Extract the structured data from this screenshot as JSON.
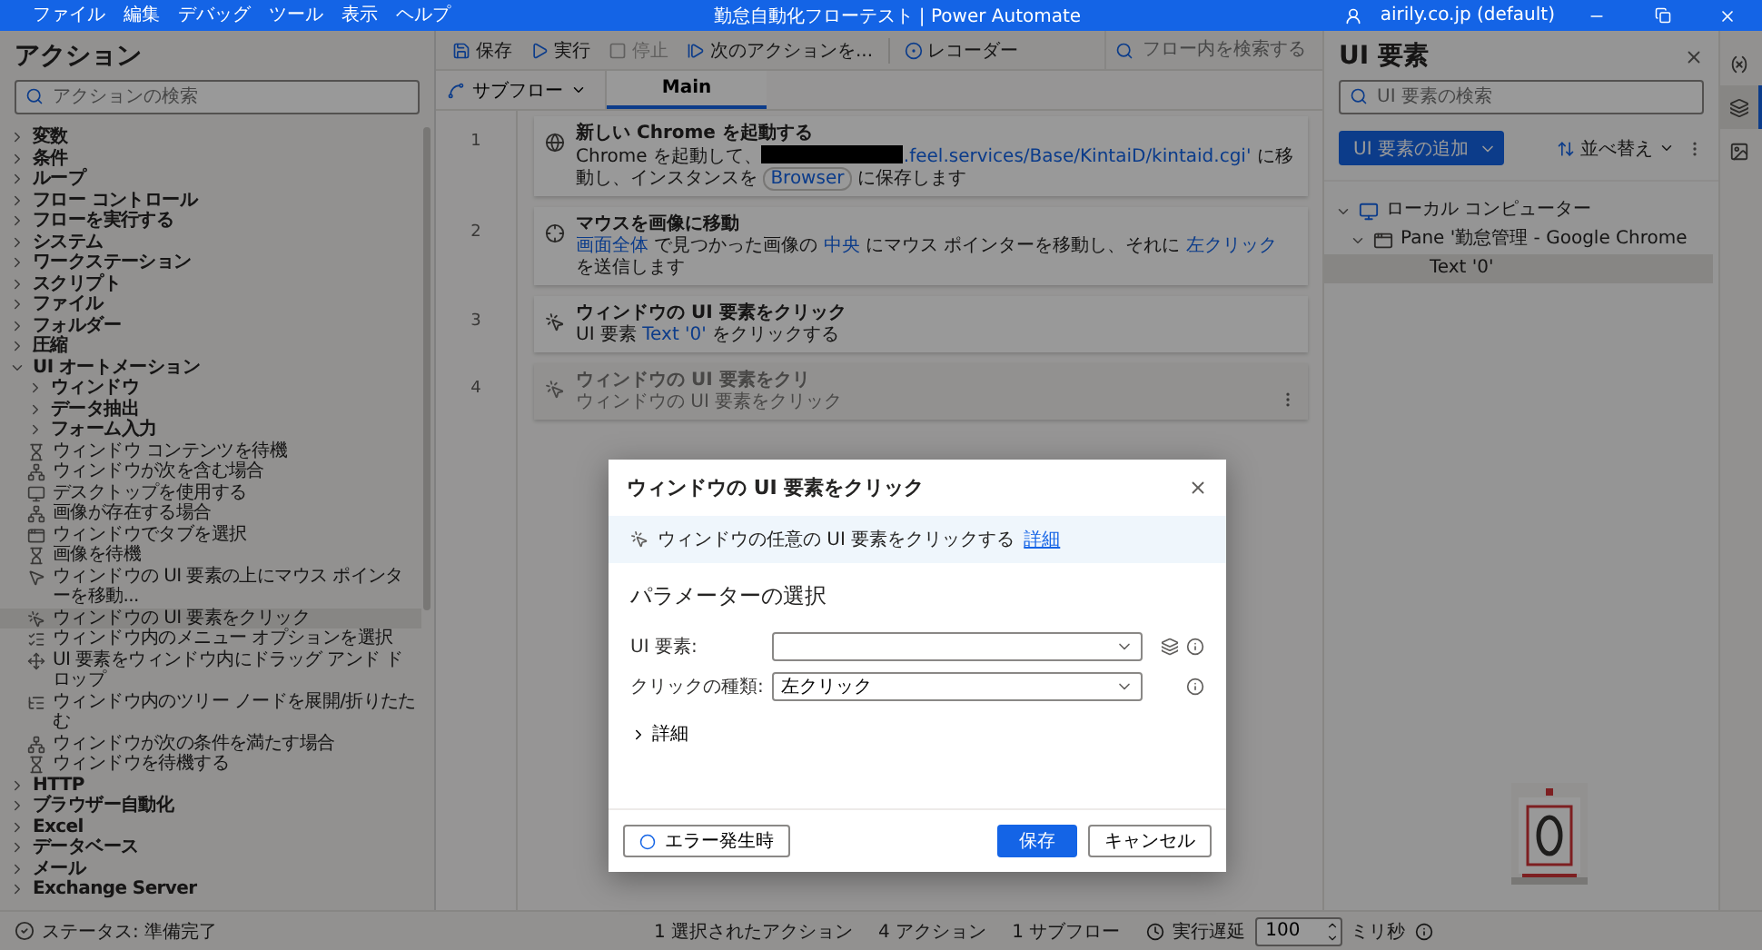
{
  "window": {
    "menu": [
      "ファイル",
      "編集",
      "デバッグ",
      "ツール",
      "表示",
      "ヘルプ"
    ],
    "title": "勤怠自動化フローテスト | Power Automate",
    "account": "airily.co.jp (default)"
  },
  "actions_panel": {
    "title": "アクション",
    "search": {
      "placeholder": "アクションの検索"
    },
    "tree": [
      {
        "label": "変数",
        "expanded": false,
        "selected": false
      },
      {
        "label": "条件",
        "expanded": false,
        "selected": false
      },
      {
        "label": "ループ",
        "expanded": false,
        "selected": false
      },
      {
        "label": "フロー コントロール",
        "expanded": false,
        "selected": false
      },
      {
        "label": "フローを実行する",
        "expanded": false,
        "selected": false
      },
      {
        "label": "システム",
        "expanded": false,
        "selected": false
      },
      {
        "label": "ワークステーション",
        "expanded": false,
        "selected": false
      },
      {
        "label": "スクリプト",
        "expanded": false,
        "selected": false
      },
      {
        "label": "ファイル",
        "expanded": false,
        "selected": false
      },
      {
        "label": "フォルダー",
        "expanded": false,
        "selected": false
      },
      {
        "label": "圧縮",
        "expanded": false,
        "selected": false
      },
      {
        "label": "UI オートメーション",
        "expanded": true,
        "selected": false,
        "children": [
          {
            "label": "ウィンドウ",
            "expanded": false,
            "selected": false
          },
          {
            "label": "データ抽出",
            "expanded": false,
            "selected": false
          },
          {
            "label": "フォーム入力",
            "expanded": false,
            "selected": false
          },
          {
            "label": "ウィンドウ コンテンツを待機",
            "kind": "wait",
            "selected": false
          },
          {
            "label": "ウィンドウが次を含む場合",
            "kind": "condition",
            "selected": false
          },
          {
            "label": "デスクトップを使用する",
            "kind": "desktop",
            "selected": false
          },
          {
            "label": "画像が存在する場合",
            "kind": "condition",
            "selected": false
          },
          {
            "label": "ウィンドウでタブを選択",
            "kind": "tab",
            "selected": false
          },
          {
            "label": "画像を待機",
            "kind": "wait",
            "selected": false
          },
          {
            "label": "ウィンドウの UI 要素の上にマウス ポインターを移動...",
            "kind": "pointer",
            "selected": false
          },
          {
            "label": "ウィンドウの UI 要素をクリック",
            "kind": "click",
            "selected": true
          },
          {
            "label": "ウィンドウ内のメニュー オプションを選択",
            "kind": "menu",
            "selected": false
          },
          {
            "label": "UI 要素をウィンドウ内にドラッグ アンド ドロップ",
            "kind": "drag",
            "selected": false
          },
          {
            "label": "ウィンドウ内のツリー ノードを展開/折りたたむ",
            "kind": "tree",
            "selected": false
          },
          {
            "label": "ウィンドウが次の条件を満たす場合",
            "kind": "condition",
            "selected": false
          },
          {
            "label": "ウィンドウを待機する",
            "kind": "wait",
            "selected": false
          }
        ]
      },
      {
        "label": "HTTP",
        "expanded": false,
        "selected": false
      },
      {
        "label": "ブラウザー自動化",
        "expanded": false,
        "selected": false
      },
      {
        "label": "Excel",
        "expanded": false,
        "selected": false
      },
      {
        "label": "データベース",
        "expanded": false,
        "selected": false
      },
      {
        "label": "メール",
        "expanded": false,
        "selected": false
      },
      {
        "label": "Exchange Server",
        "expanded": false,
        "selected": false
      }
    ]
  },
  "toolbar": {
    "buttons": [
      {
        "kind": "save",
        "label": "保存",
        "disabled": false
      },
      {
        "kind": "run",
        "label": "実行",
        "disabled": false
      },
      {
        "kind": "stop",
        "label": "停止",
        "disabled": true
      },
      {
        "kind": "next",
        "label": "次のアクションを...",
        "disabled": false
      },
      {
        "kind": "recorder",
        "label": "レコーダー",
        "disabled": false
      }
    ],
    "search": {
      "placeholder": "フロー内を検索する"
    }
  },
  "subflows": {
    "label": "サブフロー",
    "tabs": [
      {
        "label": "Main",
        "selected": true
      }
    ]
  },
  "steps": [
    {
      "number": "1",
      "kind": "browser",
      "title": "新しい Chrome を起動する",
      "selected": false,
      "description": [
        {
          "kind": "text",
          "text": "Chrome を起動して、"
        },
        {
          "kind": "redacted"
        },
        {
          "kind": "link",
          "text": ".feel.services/Base/KintaiD/kintaid.cgi'"
        },
        {
          "kind": "text",
          "text": " に移動し、インスタンスを "
        },
        {
          "kind": "chip",
          "text": "Browser"
        },
        {
          "kind": "text",
          "text": " に保存します"
        }
      ]
    },
    {
      "number": "2",
      "kind": "mouse",
      "title": "マウスを画像に移動",
      "selected": false,
      "description": [
        {
          "kind": "link",
          "text": "画面全体"
        },
        {
          "kind": "text",
          "text": " で見つかった画像の "
        },
        {
          "kind": "link",
          "text": "中央"
        },
        {
          "kind": "text",
          "text": " にマウス ポインターを移動し、それに "
        },
        {
          "kind": "link",
          "text": "左クリック"
        },
        {
          "kind": "text",
          "text": " を送信します"
        }
      ]
    },
    {
      "number": "3",
      "kind": "click",
      "title": "ウィンドウの UI 要素をクリック",
      "selected": false,
      "description": [
        {
          "kind": "text",
          "text": "UI 要素 "
        },
        {
          "kind": "link",
          "text": "Text '0'"
        },
        {
          "kind": "text",
          "text": " をクリックする"
        }
      ]
    },
    {
      "number": "4",
      "kind": "click",
      "title": "ウィンドウの UI 要素をクリ",
      "selected": true,
      "description": [
        {
          "kind": "text",
          "text": "ウィンドウの UI 要素をクリック"
        }
      ]
    }
  ],
  "dialog": {
    "title": "ウィンドウの UI 要素をクリック",
    "info": {
      "text": "ウィンドウの任意の UI 要素をクリックする",
      "link": "詳細"
    },
    "section": "パラメーターの選択",
    "fields": [
      {
        "kind": "element",
        "label": "UI 要素:"
      },
      {
        "kind": "plain",
        "label": "クリックの種類:",
        "value": "左クリック"
      }
    ],
    "advanced": {
      "label": "詳細",
      "expanded": false
    },
    "error_button": "エラー発生時",
    "save_button": "保存",
    "cancel_button": "キャンセル"
  },
  "ui_elements_panel": {
    "title": "UI 要素",
    "search": {
      "placeholder": "UI 要素の検索"
    },
    "add_button": "UI 要素の追加",
    "sort": "並べ替え",
    "tree": [
      {
        "label": "ローカル コンピューター",
        "kind": "computer",
        "expanded": true,
        "selected": false,
        "children": [
          {
            "label": "Pane '勤怠管理 - Google Chrome",
            "kind": "window",
            "expanded": true,
            "selected": false,
            "children": [
              {
                "label": "Text '0'",
                "selected": true
              }
            ]
          }
        ]
      }
    ]
  },
  "side_tabs": [
    {
      "kind": "variables",
      "selected": false
    },
    {
      "kind": "ui_elements",
      "selected": true
    },
    {
      "kind": "images",
      "selected": false
    }
  ],
  "status_bar": {
    "status": "ステータス: 準備完了",
    "selected_count": "1 選択されたアクション",
    "action_count": "4 アクション",
    "subflow_count": "1 サブフロー",
    "delay_label": "実行遅延",
    "delay_value": "100",
    "delay_unit": "ミリ秒"
  }
}
